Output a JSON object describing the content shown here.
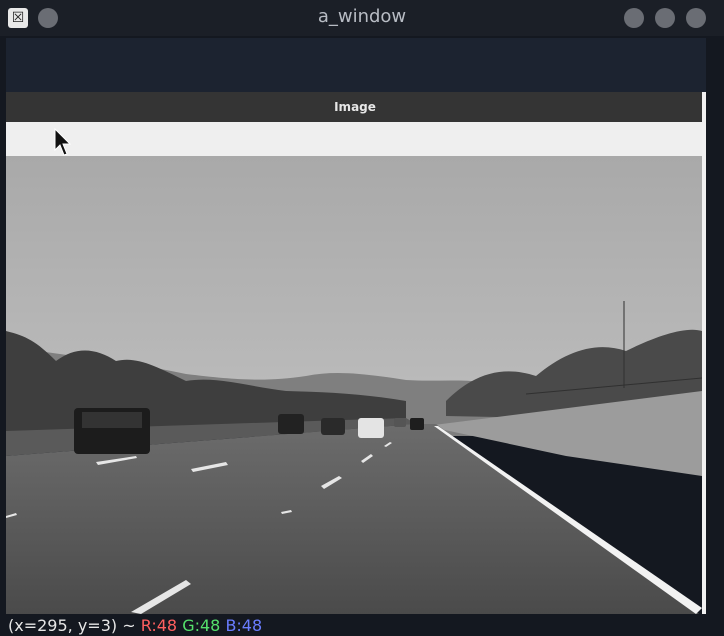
{
  "window": {
    "title": "a_window",
    "app_icon_glyph": "☒"
  },
  "image_panel": {
    "header_label": "Image"
  },
  "status_bar": {
    "coords": "(x=295, y=3) ~",
    "r": "R:48",
    "g": "G:48",
    "b": "B:48"
  },
  "colors": {
    "r": "#ff5f5f",
    "g": "#55e06b",
    "b": "#6a7dff"
  }
}
